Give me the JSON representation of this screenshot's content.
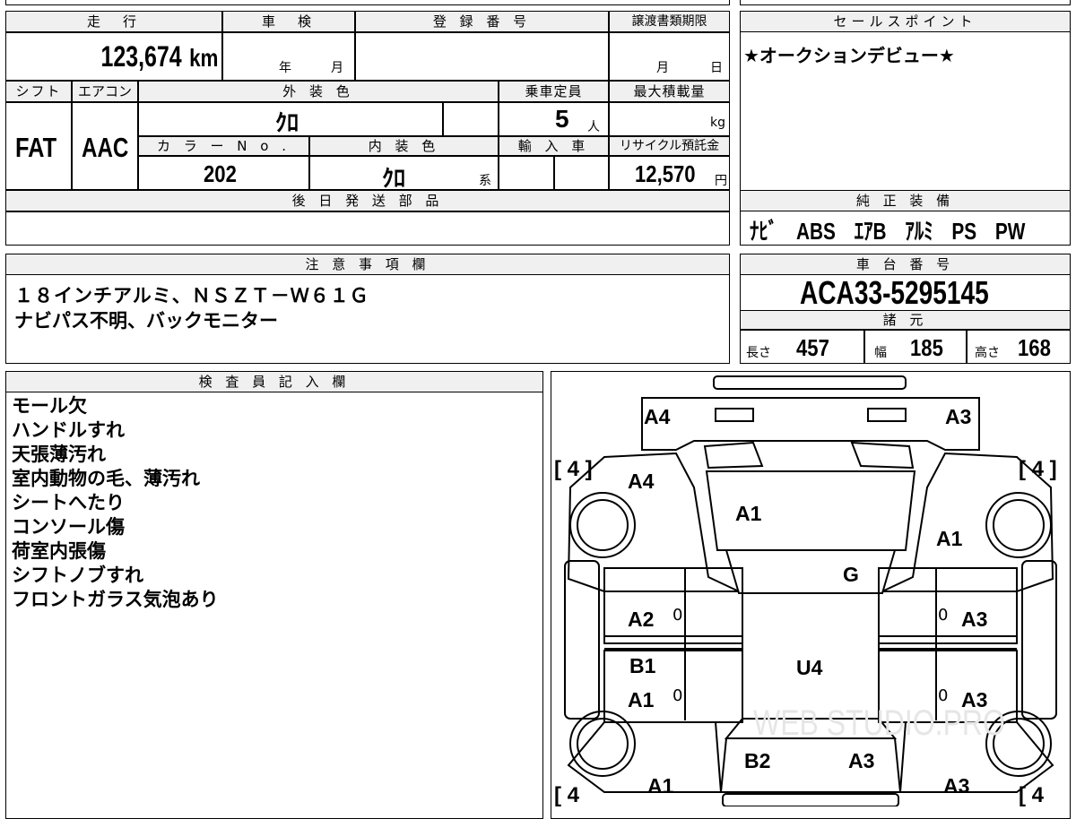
{
  "headers": {
    "mileage": "走　行",
    "shaken": "車　検",
    "registration": "登 録 番 号",
    "transfer_deadline": "譲渡書類期限",
    "sales_point": "セールスポイント",
    "shift": "シフト",
    "aircon": "エアコン",
    "exterior_color": "外 装 色",
    "capacity": "乗車定員",
    "max_load": "最大積載量",
    "color_no": "カ ラ ー N o .",
    "interior_color": "内 装 色",
    "import": "輸 入 車",
    "recycle_fee": "リサイクル預託金",
    "later_parts": "後 日 発 送 部 品",
    "standard_equipment": "純 正 装 備",
    "notes": "注 意 事 項 欄",
    "chassis_no": "車 台 番 号",
    "specs": "諸 元",
    "inspector": "検 査 員 記 入 欄"
  },
  "values": {
    "mileage": "123,674",
    "mileage_unit": "km",
    "shaken_year_unit": "年",
    "shaken_month_unit": "月",
    "transfer_month_unit": "月",
    "transfer_day_unit": "日",
    "sales_point_text": "★オークションデビュー★",
    "shift": "FAT",
    "aircon": "AAC",
    "exterior_color": "ｸﾛ",
    "capacity": "5",
    "capacity_unit": "人",
    "max_load_unit": "kg",
    "color_no": "202",
    "interior_color": "ｸﾛ",
    "interior_suffix": "系",
    "recycle_fee": "12,570",
    "recycle_unit": "円",
    "standard_equipment": "ﾅﾋﾞ　ABS　ｴｱB　ｱﾙﾐ　PS　PW",
    "notes_line1": "１８インチアルミ、ＮＳＺＴ－Ｗ６１Ｇ",
    "notes_line2": "ナビパス不明、バックモニター",
    "chassis_no": "ACA33-5295145",
    "length_label": "長さ",
    "length": "457",
    "width_label": "幅",
    "width": "185",
    "height_label": "高さ",
    "height": "168"
  },
  "inspector_notes": [
    "モール欠",
    "ハンドルすれ",
    "天張薄汚れ",
    "室内動物の毛、薄汚れ",
    "シートへたり",
    "コンソール傷",
    "荷室内張傷",
    "シフトノブすれ",
    "フロントガラス気泡あり"
  ],
  "diagram": {
    "tire_fl": "[ 4 ]",
    "tire_fr": "[ 4 ]",
    "tire_rl": "[ 4",
    "tire_rr": "[ 4",
    "marks": {
      "front_left_top": "A4",
      "front_right_top": "A3",
      "fender_left": "A4",
      "hood": "A1",
      "fender_right": "A1",
      "windshield": "G",
      "door_fl": "A2",
      "door_fr": "A3",
      "door_rl_1": "B1",
      "door_rl_2": "A1",
      "door_rr": "A3",
      "roof": "U4",
      "quarter_left": "A1",
      "trunk_left": "B2",
      "trunk_right": "A3",
      "quarter_right": "A3"
    },
    "zero_marks": [
      "0",
      "0",
      "0",
      "0"
    ],
    "watermark": "WEB STUDIO.PRO"
  }
}
